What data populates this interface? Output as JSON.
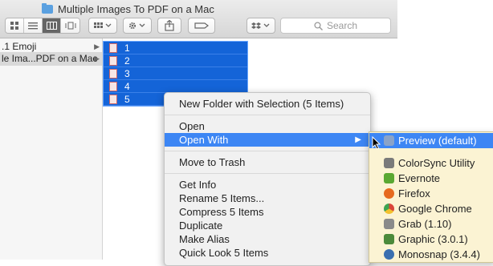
{
  "window": {
    "title": "Multiple Images To PDF on a Mac",
    "search_placeholder": "Search"
  },
  "sidebar": {
    "items": [
      {
        "label": ".1 Emoji",
        "selected": false
      },
      {
        "label": "le Ima...PDF on a Mac",
        "selected": true
      }
    ]
  },
  "files": {
    "items": [
      "1",
      "2",
      "3",
      "4",
      "5"
    ]
  },
  "context_menu": {
    "new_folder": "New Folder with Selection (5 Items)",
    "open": "Open",
    "open_with": "Open With",
    "move_to_trash": "Move to Trash",
    "get_info": "Get Info",
    "rename": "Rename 5 Items...",
    "compress": "Compress 5 Items",
    "duplicate": "Duplicate",
    "make_alias": "Make Alias",
    "quick_look": "Quick Look 5 Items"
  },
  "open_with_menu": {
    "items": [
      {
        "label": "Preview (default)",
        "icon": "preview-icon",
        "color": "#8aa3c8"
      },
      {
        "label": "ColorSync Utility",
        "icon": "colorsync-icon",
        "color": "#7a7a7a"
      },
      {
        "label": "Evernote",
        "icon": "evernote-icon",
        "color": "#5aa832"
      },
      {
        "label": "Firefox",
        "icon": "firefox-icon",
        "color": "#e66a1f"
      },
      {
        "label": "Google Chrome",
        "icon": "chrome-icon",
        "color": "#d9453a"
      },
      {
        "label": "Grab (1.10)",
        "icon": "grab-icon",
        "color": "#8a8a8a"
      },
      {
        "label": "Graphic (3.0.1)",
        "icon": "graphic-icon",
        "color": "#4b8a3a"
      },
      {
        "label": "Monosnap (3.4.4)",
        "icon": "monosnap-icon",
        "color": "#3a6fb0"
      }
    ]
  },
  "colors": {
    "selection": "#1464d8",
    "menu_highlight": "#3d86f4",
    "submenu_bg": "#fbf3d3"
  }
}
